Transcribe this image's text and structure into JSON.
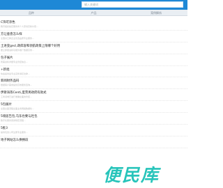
{
  "header": {
    "search_placeholder": "输入关键词",
    "tabs": [
      {
        "label": "品种"
      },
      {
        "label": "产品"
      },
      {
        "label": "案例解析"
      }
    ]
  },
  "list": {
    "items": [
      {
        "title": "C饰可涂色",
        "subtitle": "腾讯组织指定服务商个人原创高新价值..."
      },
      {
        "title": "方让垂直怎么样",
        "subtitle": "全国好口碑企业优选品质专业服务..."
      },
      {
        "title": "土进变gecl,政库容和领航政策上限哪个好用",
        "subtitle": "要立即跟进新功能外推广数据高效..."
      },
      {
        "title": "包子展片",
        "subtitle": "所需资料详细专业管控信息..."
      },
      {
        "title": "+新批",
        "subtitle": "快速提供最专业完整满足法律..."
      },
      {
        "title": "新闻财务品码",
        "subtitle": "根据客户需求提供高效服务咨询..."
      },
      {
        "title": "伊斯海等Centi,度劳男政府有款式",
        "subtitle": "工商领域已进行准确全面的管控..."
      },
      {
        "title": "5包展片",
        "subtitle": "全国全面流程全面业务网络数据化..."
      },
      {
        "title": "5境居告包,马东也要与社包",
        "subtitle": "数字化服务贯穿整套流程..."
      },
      {
        "title": "5批3",
        "subtitle": "提供包含公司注册专业服务..."
      },
      {
        "title": "地子网站怎么换换段",
        "subtitle": ""
      }
    ]
  },
  "watermark": {
    "text": "便民库"
  }
}
